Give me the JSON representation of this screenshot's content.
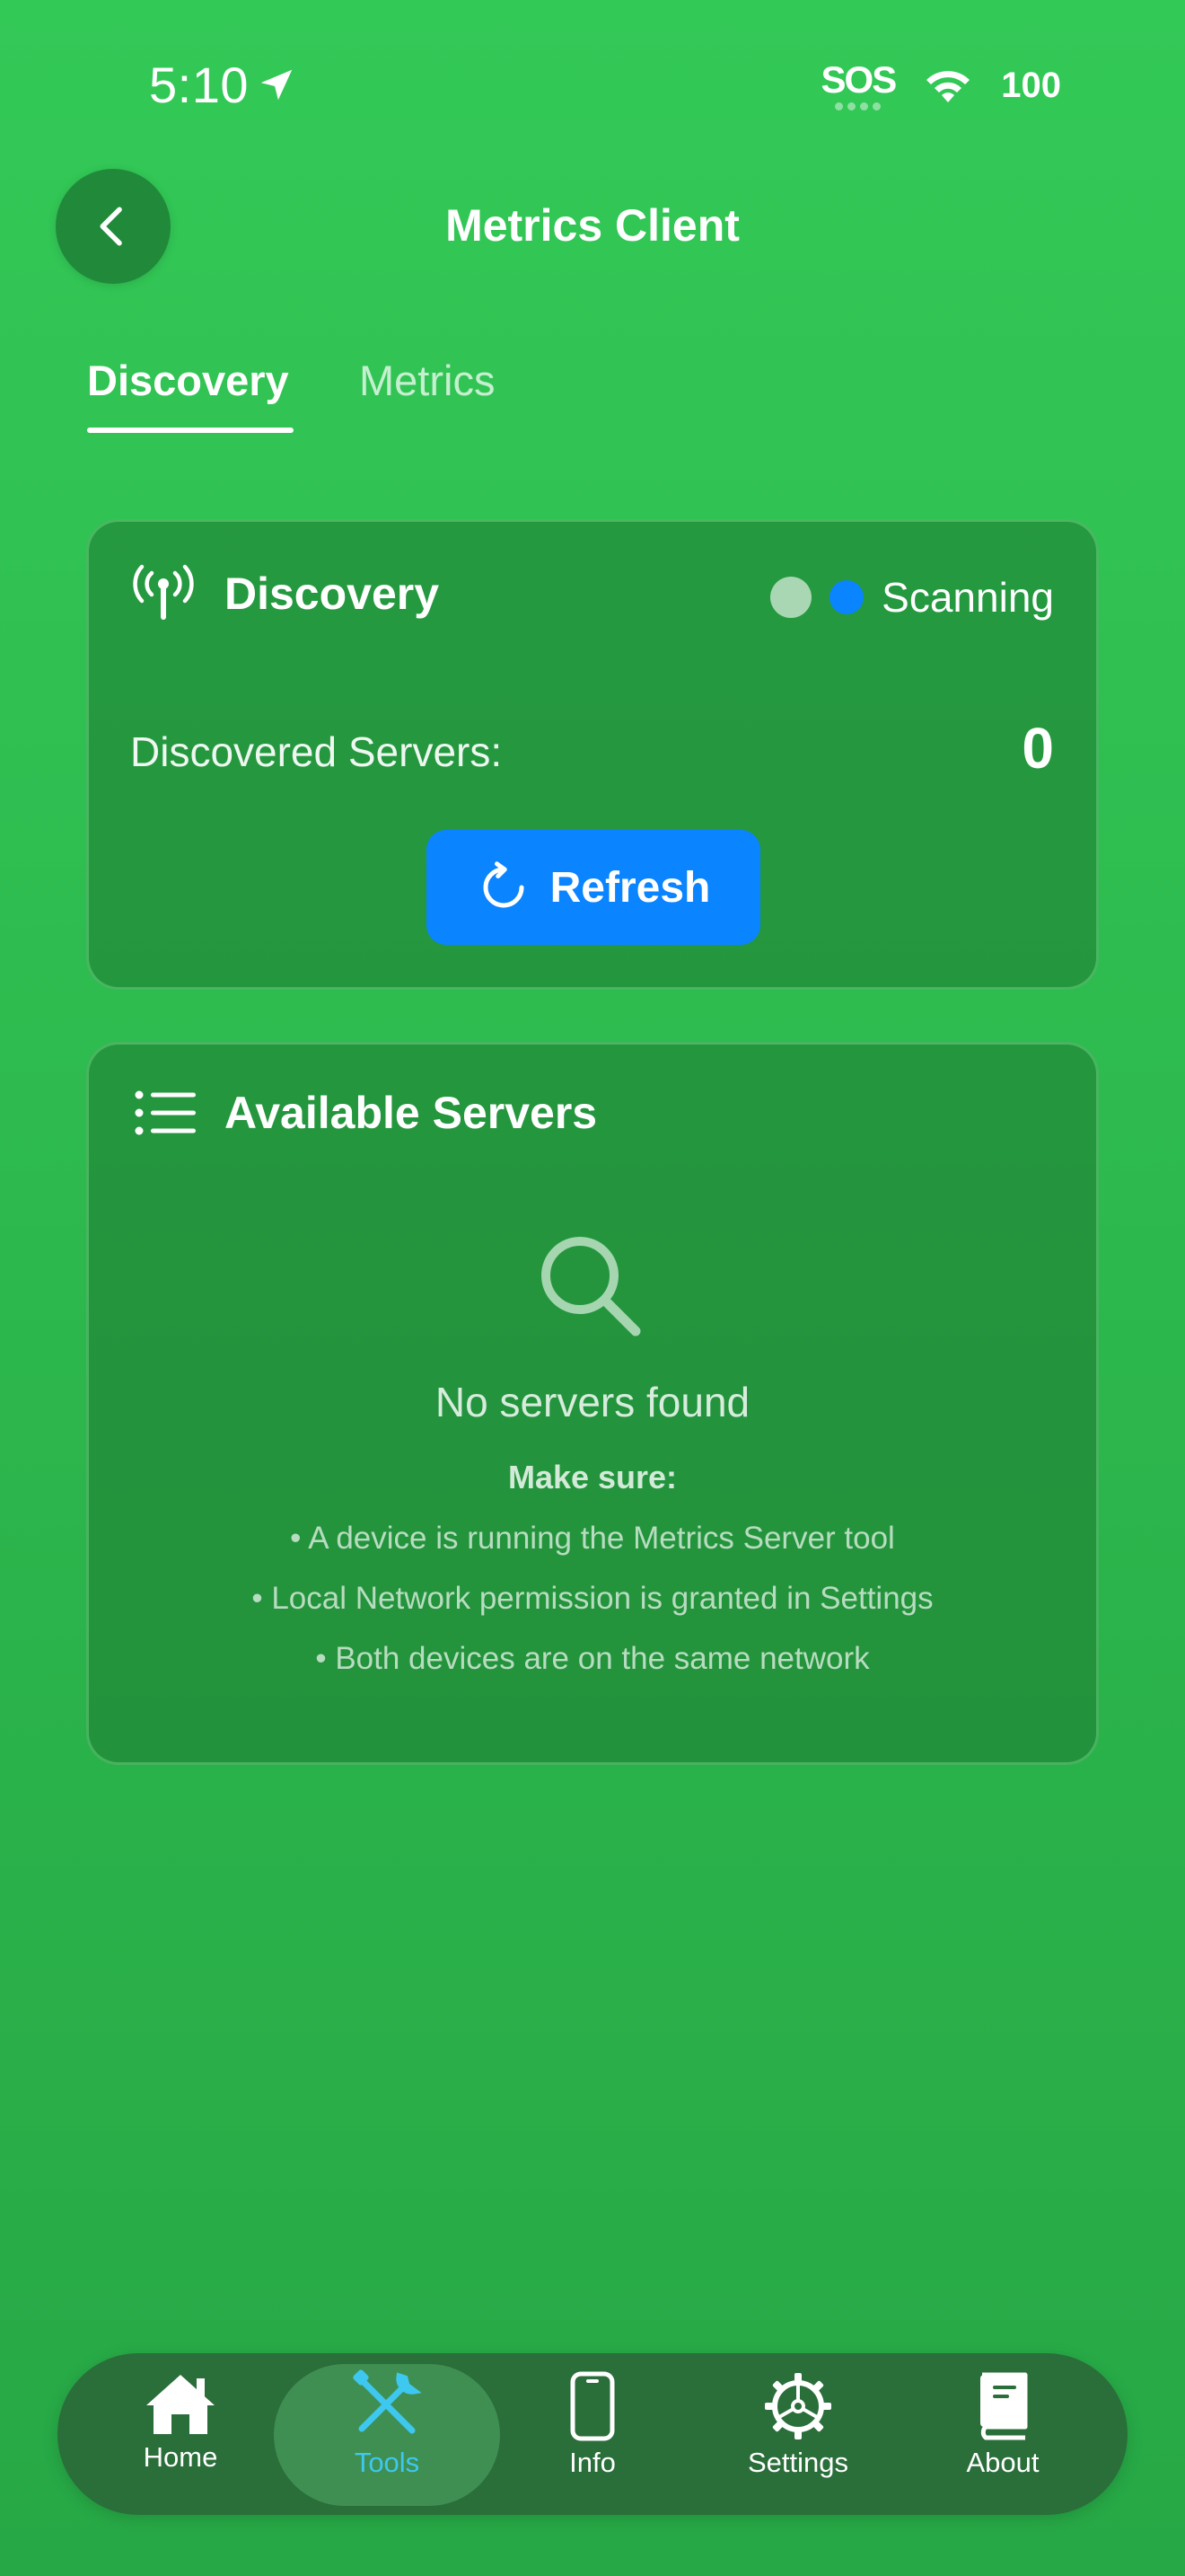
{
  "status_bar": {
    "time": "5:10",
    "sos": "SOS",
    "battery": "100"
  },
  "header": {
    "title": "Metrics Client"
  },
  "tabs": [
    {
      "label": "Discovery",
      "active": true
    },
    {
      "label": "Metrics",
      "active": false
    }
  ],
  "discovery_card": {
    "title": "Discovery",
    "status": "Scanning",
    "servers_label": "Discovered Servers:",
    "servers_count": "0",
    "refresh_label": "Refresh"
  },
  "servers_card": {
    "title": "Available Servers",
    "empty_title": "No servers found",
    "make_sure": "Make sure:",
    "tips": [
      "• A device is running the Metrics Server tool",
      "• Local Network permission is granted in Settings",
      "• Both devices are on the same network"
    ]
  },
  "tab_bar": {
    "items": [
      {
        "label": "Home",
        "icon": "house-icon"
      },
      {
        "label": "Tools",
        "icon": "tools-icon",
        "active": true
      },
      {
        "label": "Info",
        "icon": "phone-icon"
      },
      {
        "label": "Settings",
        "icon": "gear-icon"
      },
      {
        "label": "About",
        "icon": "book-icon"
      }
    ]
  },
  "colors": {
    "accent_blue": "#0a84ff",
    "active_tab": "#3ec7ef",
    "background": "#33c957"
  }
}
